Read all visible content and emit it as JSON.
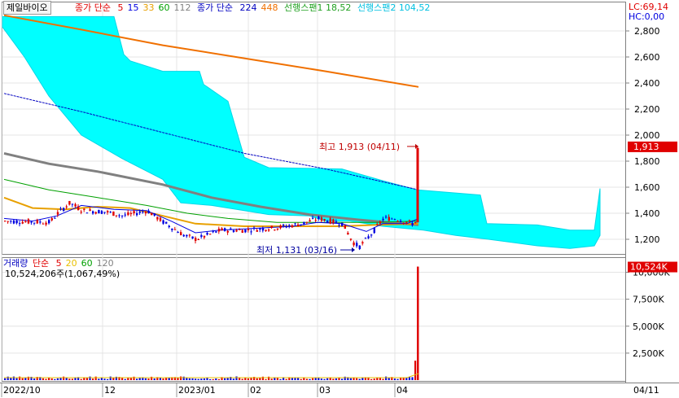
{
  "stock_name": "제일바이오",
  "price_legend": {
    "ma_short_label": "종가 단순",
    "ma_short_periods": [
      "5",
      "15",
      "33",
      "60",
      "112"
    ],
    "ma_short_colors": [
      "#e00000",
      "#0000e0",
      "#e8a000",
      "#00a000",
      "#808080"
    ],
    "ma_long_label": "종가 단순",
    "ma_long_periods": [
      "224",
      "448"
    ],
    "ma_long_colors": [
      "#0000c0",
      "#f07000"
    ],
    "span1": "선행스팬1 18,52",
    "span1_color": "#20a020",
    "span2": "선행스팬2 104,52",
    "span2_color": "#00c0e0",
    "lc": "LC:69,14",
    "hc": "HC:0,00"
  },
  "volume_legend": {
    "title": "거래량",
    "ma_label": "단순",
    "ma_periods": [
      "5",
      "20",
      "60",
      "120"
    ],
    "ma_colors": [
      "#e00000",
      "#e8c000",
      "#00a000",
      "#808080"
    ],
    "value_text": "10,524,206주(1,067,49%)"
  },
  "annotations": {
    "high": "최고 1,913 (04/11)",
    "low": "최저 1,131 (03/16)"
  },
  "current_price_label": "1,913",
  "current_volume_label": "10,524K",
  "price_axis_ticks": [
    "2,800",
    "2,600",
    "2,400",
    "2,200",
    "2,000",
    "1,800",
    "1,600",
    "1,400",
    "1,200"
  ],
  "volume_axis_ticks": [
    "10,000K",
    "7,500K",
    "5,000K",
    "2,500K"
  ],
  "x_axis_ticks": [
    "2022/10",
    "12",
    "2023/01",
    "02",
    "03",
    "04",
    "04/11"
  ],
  "chart_data": {
    "type": "candlestick",
    "price": {
      "ylim": [
        1050,
        2950
      ],
      "x": [
        "2022/10",
        "2022/11",
        "2022/12",
        "2023/01",
        "2023/02",
        "2023/03",
        "2023/04",
        "2023/04/11"
      ],
      "close_approx": [
        1340,
        1480,
        1380,
        1220,
        1300,
        1300,
        1340,
        1913
      ],
      "high": 1913,
      "high_date": "04/11",
      "low": 1131,
      "low_date": "03/16",
      "ma_224_approx": [
        2310,
        2160,
        2020,
        1880,
        1770,
        1680,
        1600
      ],
      "ma_448_approx": [
        2870,
        2760,
        2680,
        2580,
        2500,
        2430,
        2370
      ]
    },
    "volume": {
      "ylim": [
        0,
        11000
      ],
      "unit": "K",
      "last_value": 10524,
      "ticks": [
        2500,
        5000,
        7500,
        10000
      ]
    }
  }
}
